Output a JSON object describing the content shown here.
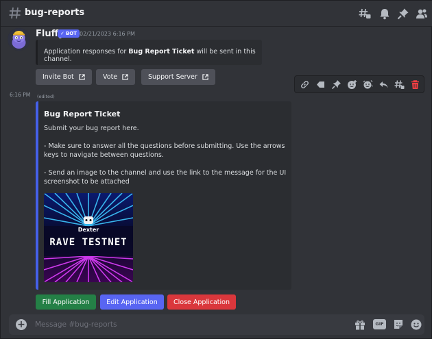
{
  "header": {
    "channel_name": "bug-reports",
    "icons": [
      "threads-icon",
      "bell-icon",
      "pin-icon",
      "members-icon"
    ]
  },
  "message1": {
    "author": "Fluffy",
    "badge": "BOT",
    "timestamp": "02/21/2023 6:16 PM",
    "notice_prefix": "Application responses for ",
    "notice_bold": "Bug Report Ticket",
    "notice_suffix": " will be sent in this channel.",
    "buttons": [
      {
        "label": "Invite Bot"
      },
      {
        "label": "Vote"
      },
      {
        "label": "Support Server"
      }
    ]
  },
  "toolbar": {
    "icons": [
      "link-icon",
      "tag-icon",
      "pin-icon",
      "reaction-icon",
      "super-reaction-icon",
      "reply-icon",
      "thread-icon",
      "delete-icon"
    ]
  },
  "message2": {
    "time": "6:16 PM",
    "edited": "(edited)",
    "embed": {
      "title": "Bug Report Ticket",
      "desc": [
        "Submit your bug report here.",
        "- Make sure to answer all the questions before submitting. Use the arrows keys to navigate between questions.",
        "- Send an image to the channel and use the link to the message for the UI screenshot to be attached"
      ],
      "image_text_top": "Dexter",
      "image_text_main": "RAVE TESTNET"
    },
    "actions": [
      {
        "label": "Fill Application",
        "color": "#248046"
      },
      {
        "label": "Edit Application",
        "color": "#5865f2"
      },
      {
        "label": "Close Application",
        "color": "#da373c"
      }
    ]
  },
  "composer": {
    "placeholder": "Message #bug-reports",
    "gif_label": "GIF"
  },
  "colors": {
    "background": "#313338",
    "embed_accent": "#4560e8",
    "delete_red": "#f23f43"
  }
}
